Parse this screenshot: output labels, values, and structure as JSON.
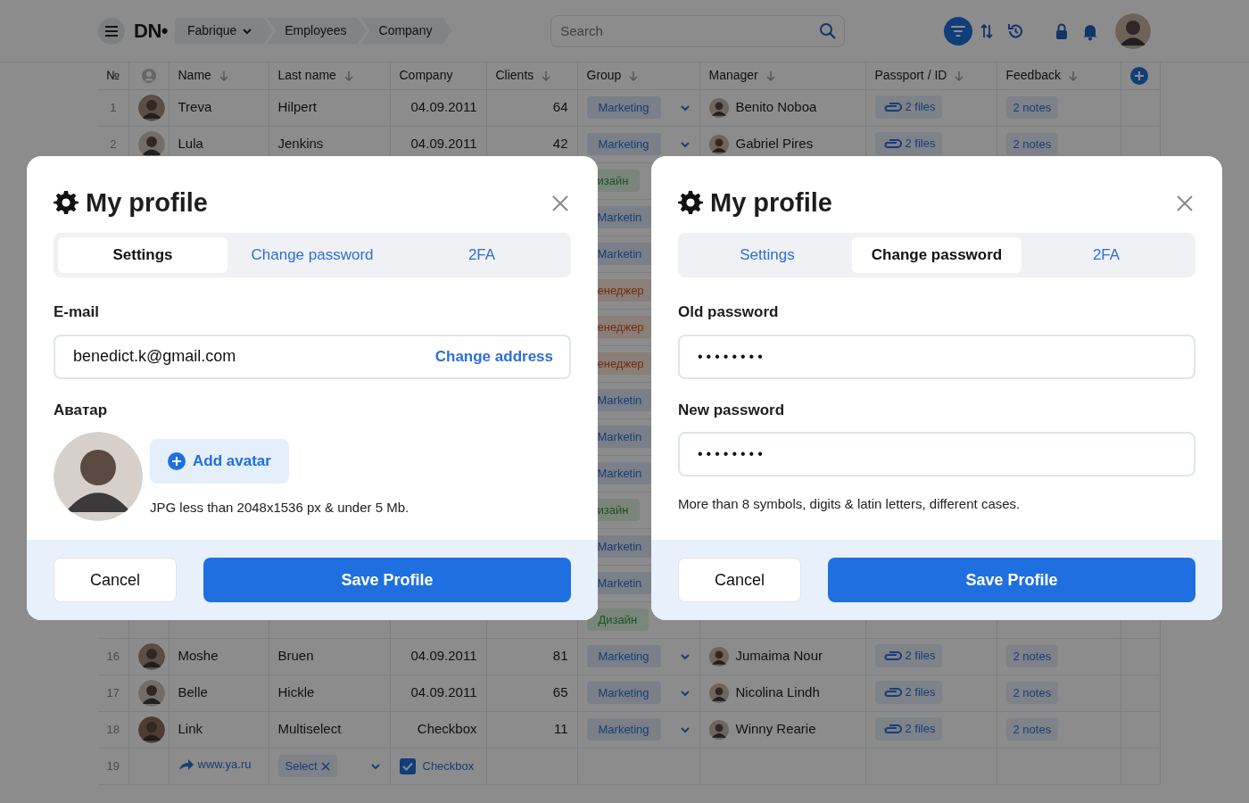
{
  "toolbar": {
    "logo": "DN•",
    "breadcrumbs": [
      {
        "label": "Fabrique",
        "dropdown": true
      },
      {
        "label": "Employees",
        "dropdown": false
      },
      {
        "label": "Company",
        "dropdown": false
      }
    ],
    "search": {
      "placeholder": "Search"
    },
    "actions": [
      {
        "kind": "filter",
        "selected": true
      },
      {
        "kind": "sort",
        "selected": false
      },
      {
        "kind": "history",
        "selected": false
      },
      {
        "kind": "lock",
        "selected": false
      },
      {
        "kind": "bell",
        "selected": false
      }
    ]
  },
  "table": {
    "columns": [
      {
        "label": "№",
        "sortable": false
      },
      {
        "kind": "avatar",
        "sortable": false
      },
      {
        "label": "Name",
        "sortable": true
      },
      {
        "label": "Last name",
        "sortable": true
      },
      {
        "label": "Company",
        "sortable": false
      },
      {
        "label": "Clients",
        "sortable": true
      },
      {
        "label": "Group",
        "sortable": true
      },
      {
        "label": "Manager",
        "sortable": true
      },
      {
        "label": "Passport / ID",
        "sortable": true
      },
      {
        "label": "Feedback",
        "sortable": true
      }
    ],
    "rows": [
      {
        "kind": "full",
        "number": "1",
        "name": "Treva",
        "last_name": "Hilpert",
        "company": "04.09.2011",
        "clients": "64",
        "group": {
          "label": "Marketing",
          "kind": "marketing"
        },
        "manager": "Benito Noboa",
        "passport": "2 files",
        "feedback": "2 notes"
      },
      {
        "kind": "full",
        "number": "2",
        "name": "Lula",
        "last_name": "Jenkins",
        "company": "04.09.2011",
        "clients": "42",
        "group": {
          "label": "Marketing",
          "kind": "marketing"
        },
        "manager": "Gabriel Pires",
        "passport": "2 files",
        "feedback": "2 notes"
      },
      {
        "kind": "covered",
        "group": {
          "label": "изайн",
          "kind": "design"
        }
      },
      {
        "kind": "covered",
        "group": {
          "label": "Marketin",
          "kind": "marketing"
        }
      },
      {
        "kind": "covered",
        "group": {
          "label": "Marketin",
          "kind": "marketing"
        }
      },
      {
        "kind": "covered",
        "group": {
          "label": "енеджер",
          "kind": "manager"
        }
      },
      {
        "kind": "covered",
        "group": {
          "label": "енеджер",
          "kind": "manager"
        }
      },
      {
        "kind": "covered",
        "group": {
          "label": "енеджер",
          "kind": "manager"
        }
      },
      {
        "kind": "covered",
        "group": {
          "label": "Marketin",
          "kind": "marketing"
        }
      },
      {
        "kind": "covered",
        "group": {
          "label": "Marketin",
          "kind": "marketing"
        }
      },
      {
        "kind": "covered",
        "group": {
          "label": "Marketin",
          "kind": "marketing"
        }
      },
      {
        "kind": "covered",
        "group": {
          "label": "изайн",
          "kind": "design"
        }
      },
      {
        "kind": "covered",
        "group": {
          "label": "Marketin",
          "kind": "marketing"
        }
      },
      {
        "kind": "covered",
        "group": {
          "label": "Marketin",
          "kind": "marketing"
        }
      },
      {
        "kind": "below",
        "group": {
          "label": "Дизайн",
          "kind": "design"
        }
      },
      {
        "kind": "full",
        "number": "16",
        "name": "Moshe",
        "last_name": "Bruen",
        "company": "04.09.2011",
        "clients": "81",
        "group": {
          "label": "Marketing",
          "kind": "marketing"
        },
        "manager": "Jumaima Nour",
        "passport": "2 files",
        "feedback": "2 notes"
      },
      {
        "kind": "full",
        "number": "17",
        "name": "Belle",
        "last_name": "Hickle",
        "company": "04.09.2011",
        "clients": "65",
        "group": {
          "label": "Marketing",
          "kind": "marketing"
        },
        "manager": "Nicolina Lindh",
        "passport": "2 files",
        "feedback": "2 notes"
      },
      {
        "kind": "full",
        "number": "18",
        "name": "Link",
        "last_name": "Multiselect",
        "company": "Checkbox",
        "clients": "11",
        "group": {
          "label": "Marketing",
          "kind": "marketing"
        },
        "manager": "Winny Rearie",
        "passport": "2 files",
        "feedback": "2 notes"
      },
      {
        "kind": "editor",
        "number": "19",
        "link": "www.ya.ru",
        "select": "Select",
        "checkbox": {
          "label": "Checkbox",
          "checked": true
        }
      }
    ]
  },
  "dialogs": [
    {
      "title": "My profile",
      "tabs": [
        {
          "label": "Settings",
          "selected": true
        },
        {
          "label": "Change password",
          "selected": false
        },
        {
          "label": "2FA",
          "selected": false
        }
      ],
      "fields": [
        {
          "kind": "email",
          "label": "E-mail",
          "value": "benedict.k@gmail.com",
          "action": "Change address"
        },
        {
          "kind": "avatar",
          "label": "Аватар",
          "button": "Add avatar",
          "hint": "JPG less than 2048x1536 px & under 5 Mb."
        }
      ],
      "buttons": [
        {
          "label": "Cancel",
          "kind": "secondary"
        },
        {
          "label": "Save Profile",
          "kind": "primary"
        }
      ]
    },
    {
      "title": "My profile",
      "tabs": [
        {
          "label": "Settings",
          "selected": false
        },
        {
          "label": "Change password",
          "selected": true
        },
        {
          "label": "2FA",
          "selected": false
        }
      ],
      "fields": [
        {
          "kind": "password",
          "label": "Old password",
          "value": "••••••••"
        },
        {
          "kind": "password",
          "label": "New password",
          "value": "••••••••"
        },
        {
          "kind": "hint",
          "text": "More than 8 symbols, digits & latin letters, different cases."
        }
      ],
      "buttons": [
        {
          "label": "Cancel",
          "kind": "secondary"
        },
        {
          "label": "Save Profile",
          "kind": "primary"
        }
      ]
    }
  ]
}
